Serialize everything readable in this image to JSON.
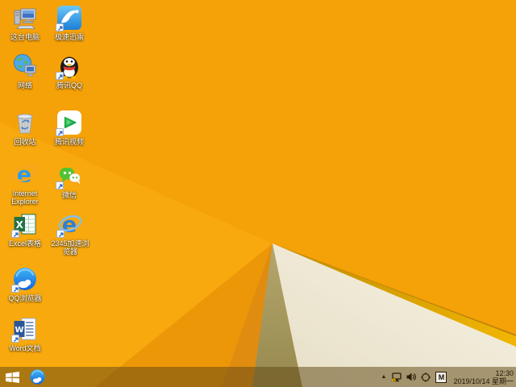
{
  "desktop": {
    "icons": [
      {
        "id": "this-pc",
        "label": "这台电脑",
        "shortcut": false
      },
      {
        "id": "xunlei",
        "label": "极速迅雷",
        "shortcut": true
      },
      {
        "id": "network",
        "label": "网络",
        "shortcut": false
      },
      {
        "id": "tencent-qq",
        "label": "腾讯QQ",
        "shortcut": true
      },
      {
        "id": "recycle-bin",
        "label": "回收站",
        "shortcut": false
      },
      {
        "id": "tencent-video",
        "label": "腾讯视频",
        "shortcut": true
      },
      {
        "id": "internet-explorer",
        "label_lines": [
          "Internet",
          "Explorer"
        ],
        "shortcut": false
      },
      {
        "id": "wechat",
        "label": "微信",
        "shortcut": true
      },
      {
        "id": "excel",
        "label": "Excel表格",
        "shortcut": true
      },
      {
        "id": "browser-2345",
        "label_lines": [
          "2345加速浏",
          "览器"
        ],
        "shortcut": true
      },
      {
        "id": "qq-browser",
        "label": "QQ浏览器",
        "shortcut": true
      },
      {
        "id": "word",
        "label": "Word文档",
        "shortcut": true
      }
    ],
    "wallpaper_colors": {
      "base": "#F5A108",
      "wedge_light": "#F8A90D",
      "wedge_mid": "#EC9708",
      "wedge_dark": "#E08C10",
      "olive_top": "#B4A76D",
      "olive_bottom": "#97894E",
      "gold_edge_start": "#BE8A00",
      "gold_edge_end": "#F2B602",
      "paper_light": "#F6F2E4",
      "paper_shade": "#E7DFC6"
    }
  },
  "taskbar": {
    "tint": "rgba(97,72,22,0.52)",
    "start": {
      "icon": "windows-logo"
    },
    "pinned": [
      {
        "id": "qq-browser-task"
      }
    ],
    "tray": {
      "icons": [
        "hidden-icons-chevron",
        "network-warning-icon",
        "volume-icon",
        "safety-icon"
      ],
      "ime": "M",
      "time": "12:30",
      "date": "2019/10/14 星期一"
    }
  }
}
